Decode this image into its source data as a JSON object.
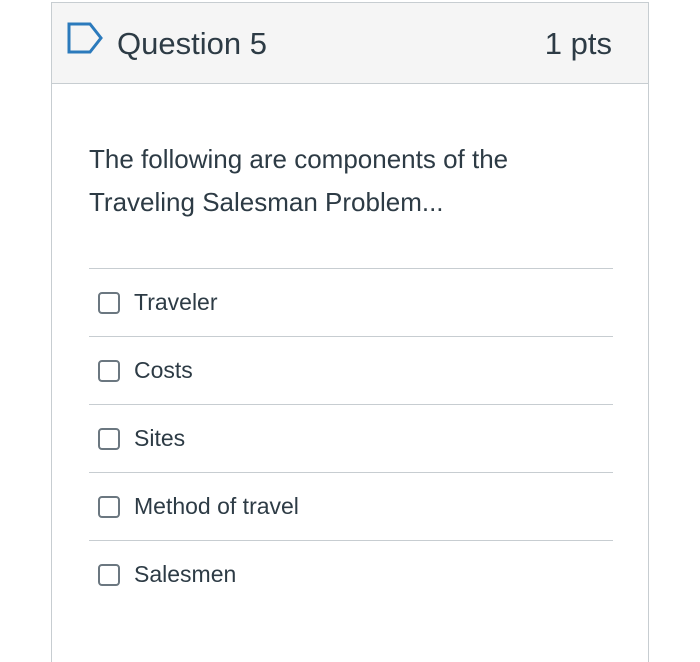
{
  "question": {
    "title": "Question 5",
    "points": "1 pts",
    "text_line1": "The following are components of the",
    "text_line2": "Traveling Salesman Problem...",
    "answers": [
      {
        "label": "Traveler"
      },
      {
        "label": "Costs"
      },
      {
        "label": "Sites"
      },
      {
        "label": "Method of travel"
      },
      {
        "label": "Salesmen"
      }
    ]
  },
  "colors": {
    "accent": "#2b7abc",
    "border": "#c7cdd1",
    "header_bg": "#f5f5f5",
    "text": "#2d3b45"
  },
  "icons": {
    "flag": "flag-question-icon"
  }
}
